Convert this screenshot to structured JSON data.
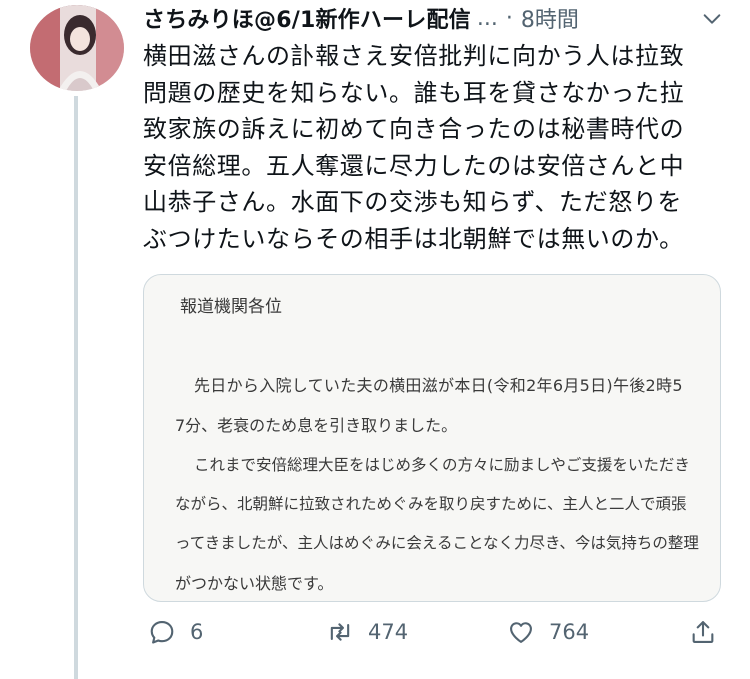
{
  "tweet": {
    "display_name": "さちみりほ@6/1新作ハーレ配信",
    "ellipsis": "...",
    "separator": "·",
    "time": "8時間",
    "text_lines": [
      "横田滋さんの訃報さえ安倍批判に向かう人は拉致",
      "問題の歴史を知らない。誰も耳を貸さなかった拉",
      "致家族の訴えに初めて向き合ったのは秘書時代の",
      "安倍総理。五人奪還に尽力したのは安倍さんと中",
      "山恭子さん。水面下の交渉も知らず、ただ怒りを",
      "ぶつけたいならその相手は北朝鮮では無いのか。"
    ]
  },
  "media": {
    "lines": [
      "報道機関各位",
      "先日から入院していた夫の横田滋が本日(令和2年6月5日)午後2時5",
      "7分、老衰のため息を引き取りました。",
      "これまで安倍総理大臣をはじめ多くの方々に励ましやご支援をいただき",
      "ながら、北朝鮮に拉致されためぐみを取り戻すために、主人と二人で頑張",
      "ってきましたが、主人はめぐみに会えることなく力尽き、今は気持ちの整理",
      "がつかない状態です。"
    ]
  },
  "actions": {
    "reply_count": "6",
    "retweet_count": "474",
    "like_count": "764"
  },
  "icons": {
    "more": "chevron-down-icon",
    "reply": "reply-icon",
    "retweet": "retweet-icon",
    "like": "heart-icon",
    "share": "share-icon"
  },
  "colors": {
    "text": "#0f1419",
    "secondary": "#536471",
    "border": "#cfd9de"
  }
}
